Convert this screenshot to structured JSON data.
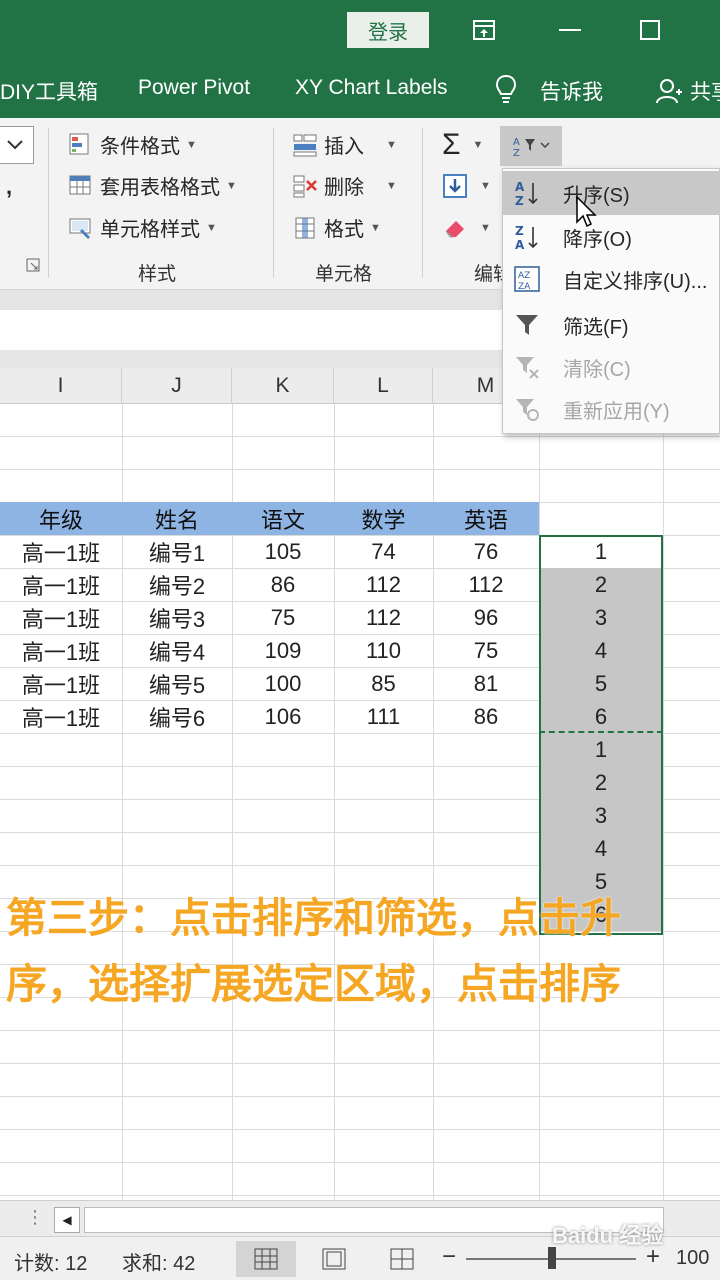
{
  "titlebar": {
    "login_label": "登录"
  },
  "tabs": [
    {
      "label": "DIY工具箱"
    },
    {
      "label": "Power Pivot"
    },
    {
      "label": "XY Chart Labels"
    },
    {
      "label": "告诉我"
    },
    {
      "label": "共享"
    }
  ],
  "ribbon": {
    "styles_group": {
      "items": [
        "条件格式",
        "套用表格格式",
        "单元格样式"
      ],
      "label": "样式"
    },
    "cells_group": {
      "items": [
        "插入",
        "删除",
        "格式"
      ],
      "label": "单元格"
    },
    "edit_group": {
      "label": "编辑"
    }
  },
  "menu": {
    "items": [
      {
        "label": "升序(S)",
        "icon": "sort-ascending-icon"
      },
      {
        "label": "降序(O)",
        "icon": "sort-descending-icon"
      },
      {
        "label": "自定义排序(U)...",
        "icon": "custom-sort-icon"
      },
      {
        "label": "筛选(F)",
        "icon": "filter-icon"
      },
      {
        "label": "清除(C)",
        "icon": "clear-filter-icon"
      },
      {
        "label": "重新应用(Y)",
        "icon": "reapply-filter-icon"
      }
    ]
  },
  "columns": [
    "I",
    "J",
    "K",
    "L",
    "M"
  ],
  "table": {
    "headers": [
      "年级",
      "姓名",
      "语文",
      "数学",
      "英语"
    ],
    "rows": [
      [
        "高一1班",
        "编号1",
        "105",
        "74",
        "76"
      ],
      [
        "高一1班",
        "编号2",
        "86",
        "112",
        "112"
      ],
      [
        "高一1班",
        "编号3",
        "75",
        "112",
        "96"
      ],
      [
        "高一1班",
        "编号4",
        "109",
        "110",
        "75"
      ],
      [
        "高一1班",
        "编号5",
        "100",
        "85",
        "81"
      ],
      [
        "高一1班",
        "编号6",
        "106",
        "111",
        "86"
      ]
    ]
  },
  "helper_column": [
    "1",
    "2",
    "3",
    "4",
    "5",
    "6",
    "1",
    "2",
    "3",
    "4",
    "5",
    "6"
  ],
  "caption": {
    "line1": "第三步：点击排序和筛选，点击升",
    "line2": "序，选择扩展选定区域，点击排序"
  },
  "statusbar": {
    "count": "计数: 12",
    "sum": "求和: 42",
    "zoom": "100"
  },
  "watermark": "Baidu 经验",
  "colors": {
    "excel_green": "#217346",
    "header_blue": "#8eb4e3",
    "caption_orange": "#f5a623"
  }
}
